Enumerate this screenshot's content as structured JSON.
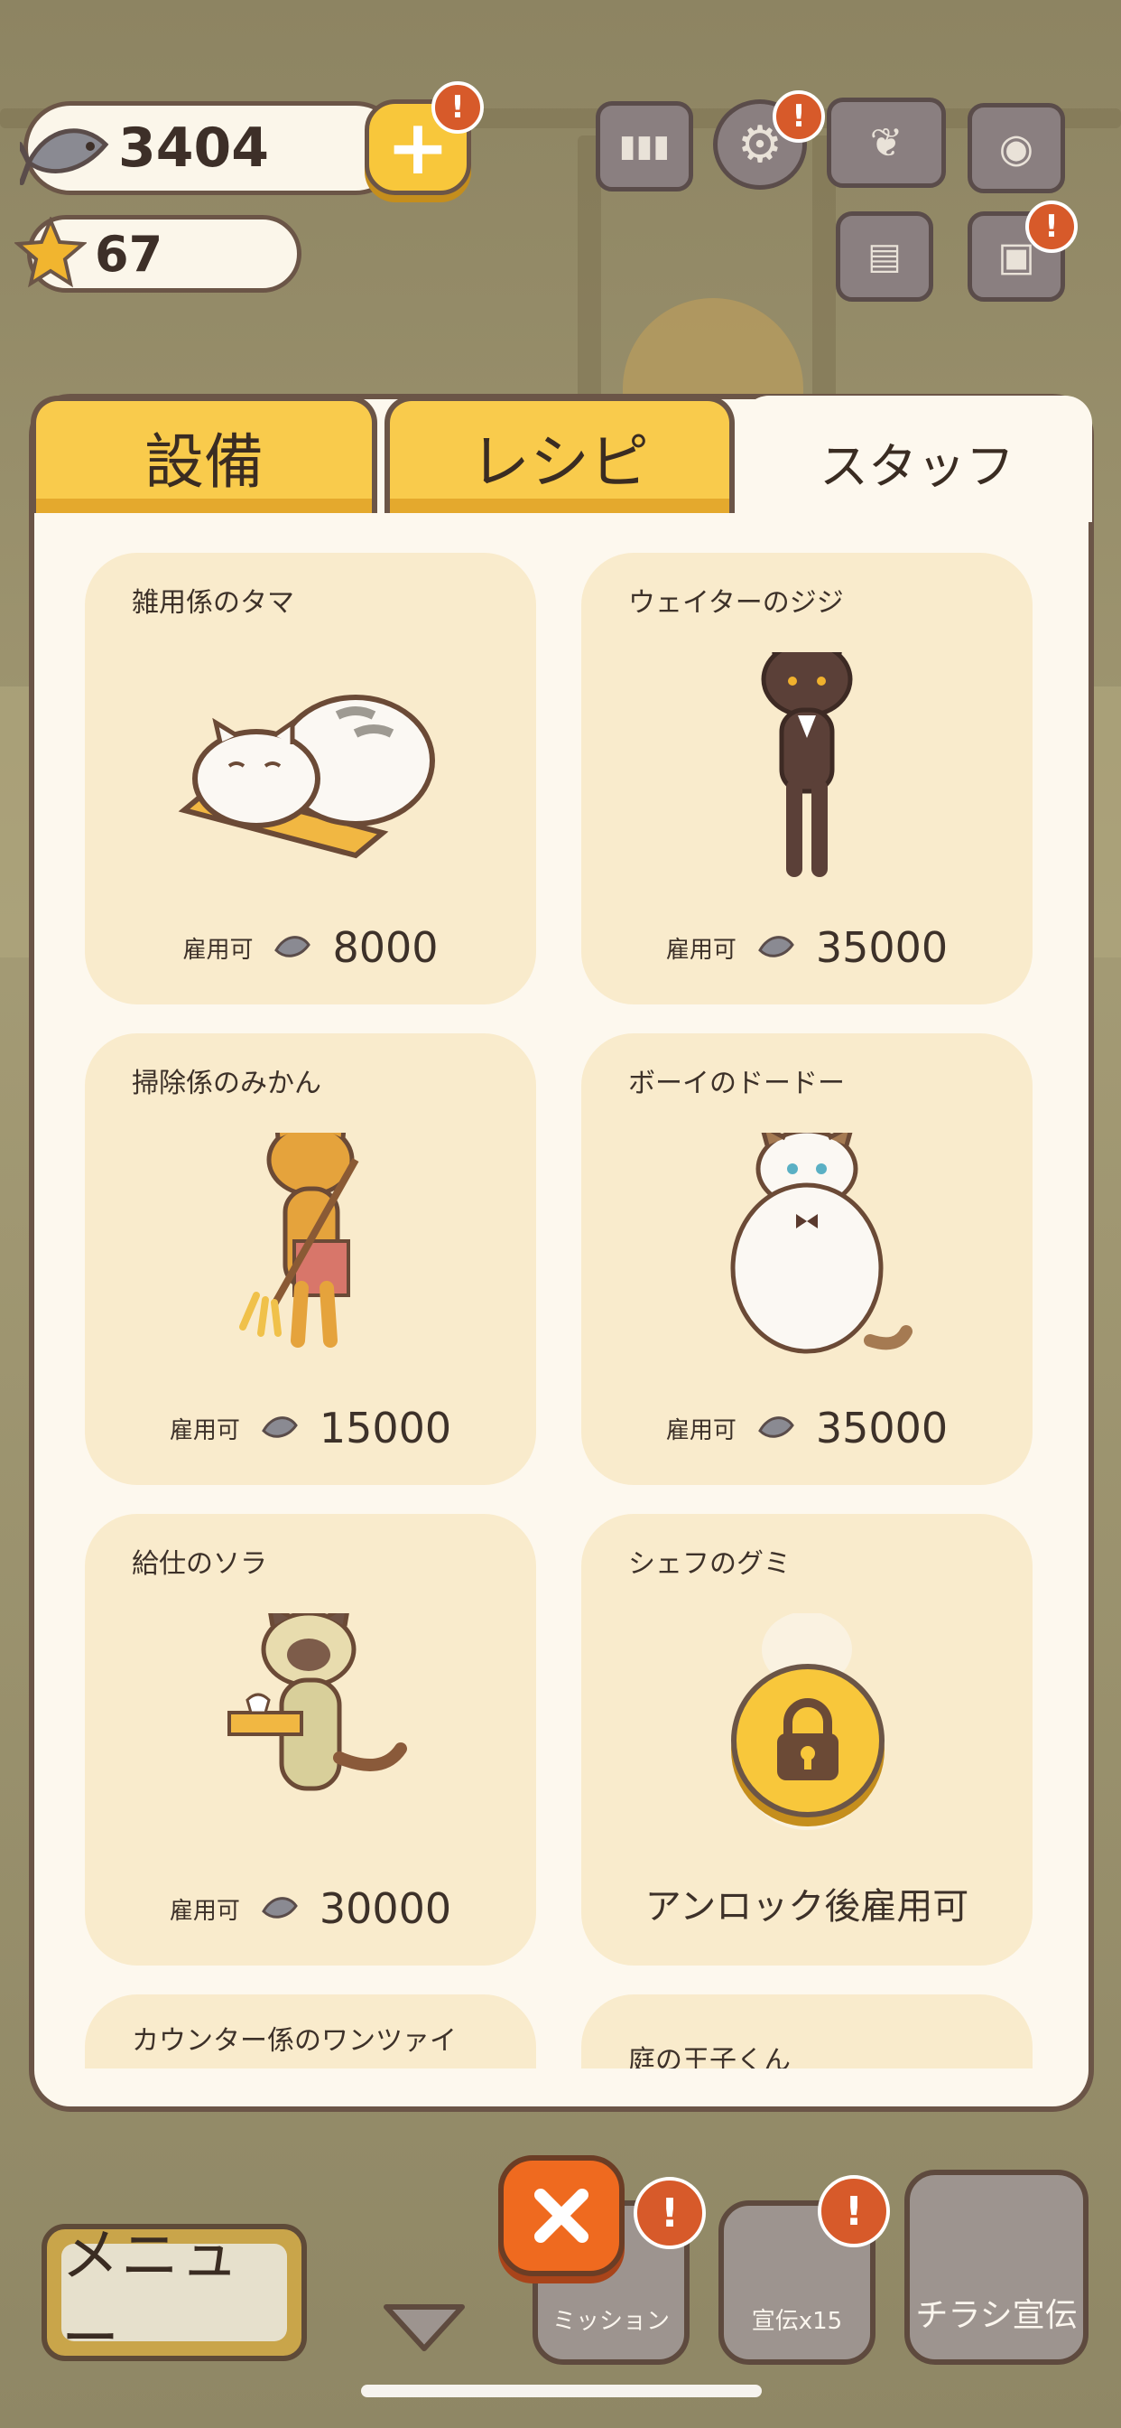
{
  "hud": {
    "fish_count": "3404",
    "star_count": "67",
    "plus_symbol": "+",
    "alert_symbol": "!"
  },
  "tabs": [
    {
      "label": "設備",
      "active": false
    },
    {
      "label": "レシピ",
      "active": false
    },
    {
      "label": "スタッフ",
      "active": true
    }
  ],
  "staff": [
    {
      "name": "雑用係のタマ",
      "status": "雇用可",
      "price": "8000",
      "locked": false
    },
    {
      "name": "ウェイターのジジ",
      "status": "雇用可",
      "price": "35000",
      "locked": false
    },
    {
      "name": "掃除係のみかん",
      "status": "雇用可",
      "price": "15000",
      "locked": false
    },
    {
      "name": "ボーイのドードー",
      "status": "雇用可",
      "price": "35000",
      "locked": false
    },
    {
      "name": "給仕のソラ",
      "status": "雇用可",
      "price": "30000",
      "locked": false
    },
    {
      "name": "シェフのグミ",
      "status": "アンロック後雇用可",
      "locked": true
    },
    {
      "name": "カウンター係のワンツァイ",
      "locked": false
    },
    {
      "name": "庭の王子くん",
      "locked": false
    }
  ],
  "bottom": {
    "menu_label": "メニュー",
    "mission_label": "ミッション",
    "promo_label": "宣伝x15",
    "flyer_label": "チラシ宣伝"
  },
  "colors": {
    "accent_yellow": "#f8c73b",
    "card_bg": "#f9ebcc",
    "panel_bg": "#fdf8ee",
    "outline_brown": "#6b5547",
    "alert_orange": "#d75a2a",
    "close_orange": "#ef6a1f"
  },
  "icons": [
    "fish-icon",
    "plus-icon",
    "star-icon",
    "ranking-icon",
    "gear-icon",
    "cookbook-icon",
    "camera-icon",
    "newspaper-icon",
    "gift-icon",
    "lock-icon",
    "close-icon",
    "collapse-arrow-icon"
  ]
}
